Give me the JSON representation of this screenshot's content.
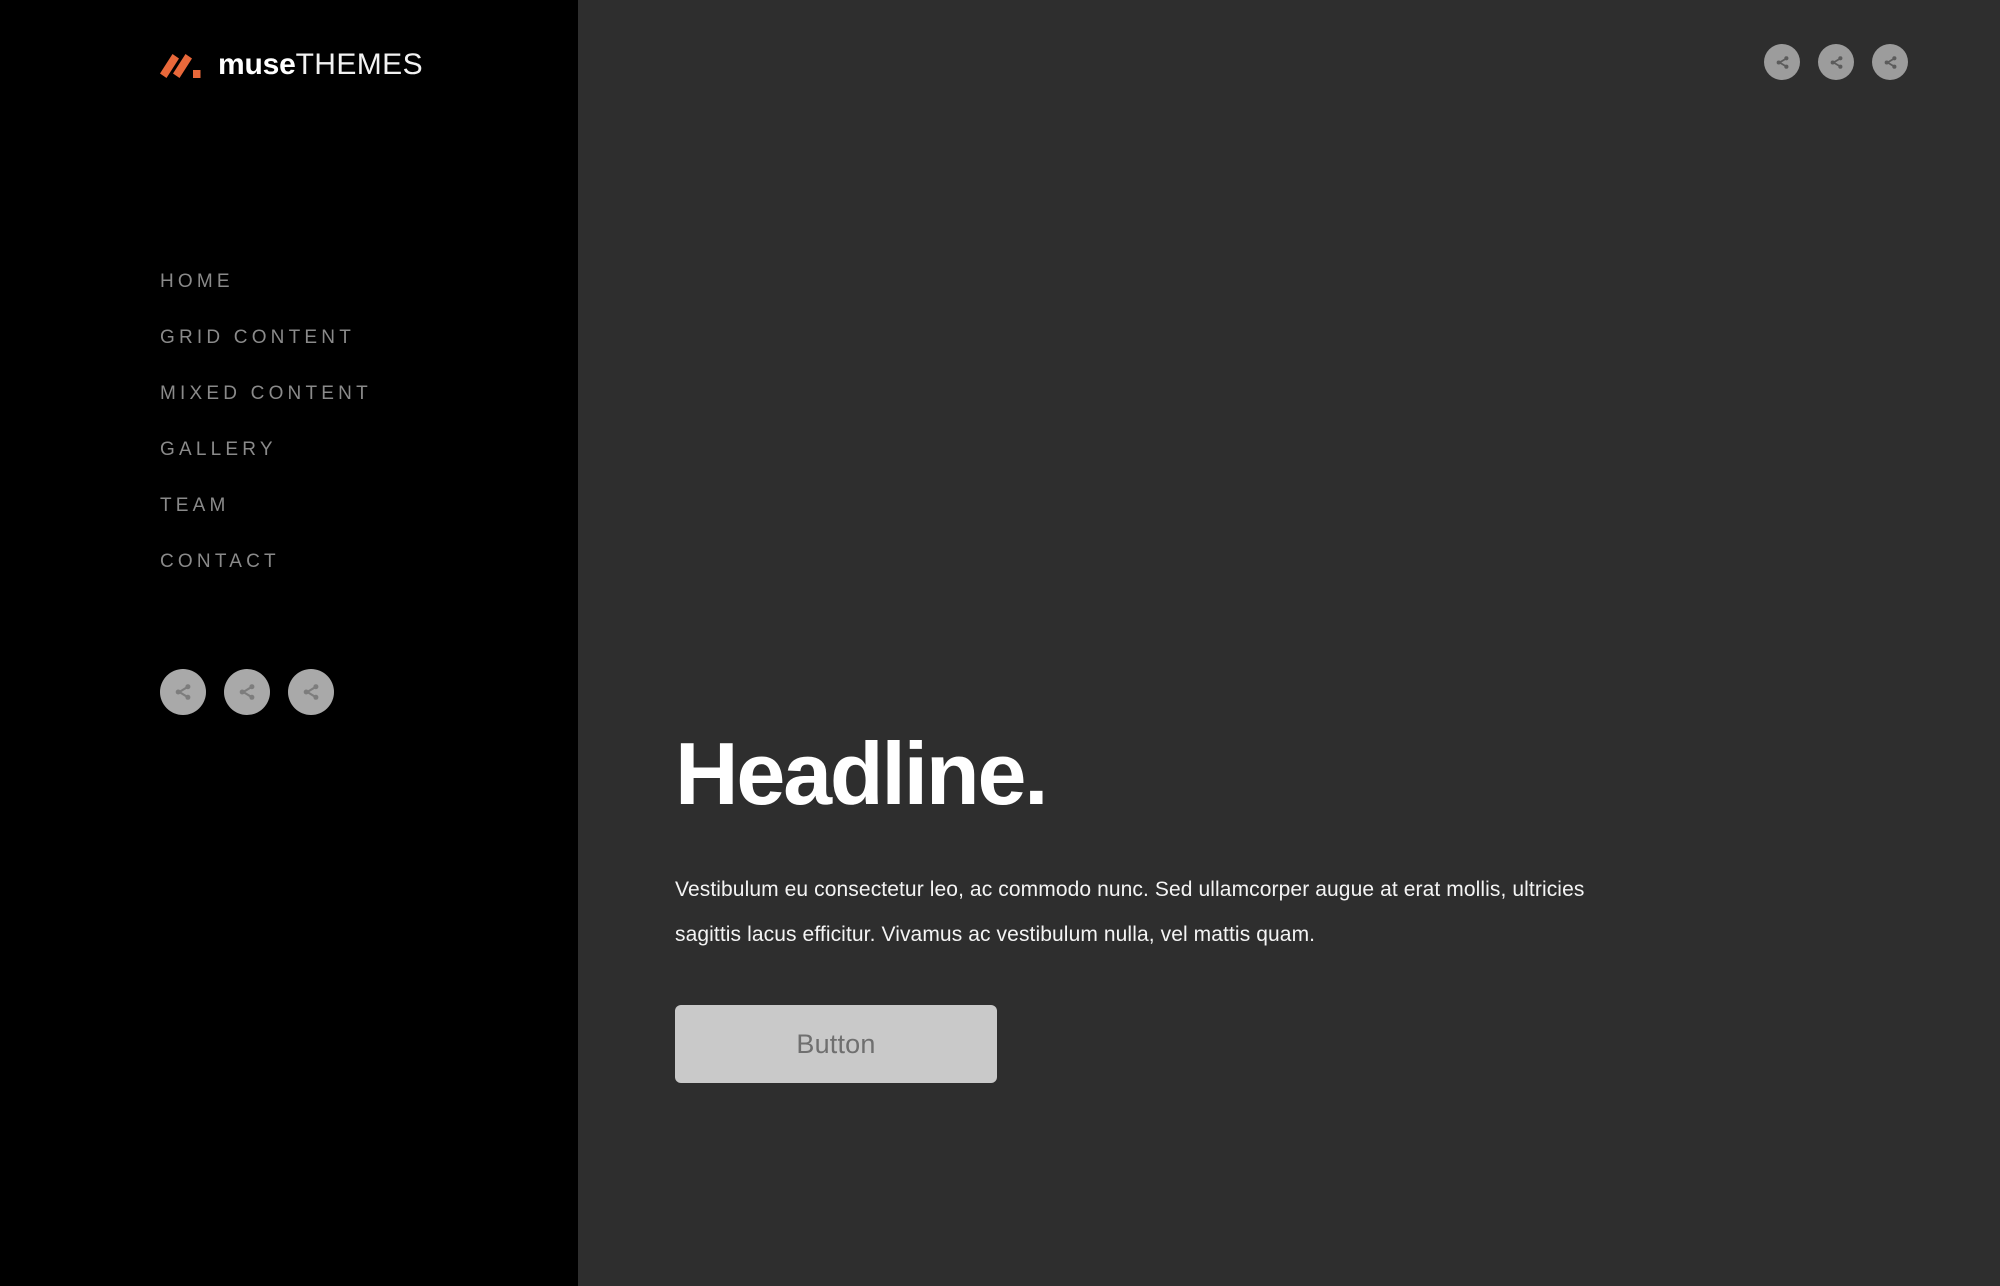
{
  "theme": {
    "sidebar_bg": "#000000",
    "main_bg": "#2e2e2e",
    "accent_orange": "#e9683a",
    "nav_text": "#8a8a8a",
    "headline_text": "#ffffff",
    "button_bg": "#c9c9c9",
    "button_text": "#6f6f6f",
    "social_circle": "#a9a9a9"
  },
  "sidebar": {
    "logo": {
      "mark_name": "muse-chevron-mark",
      "primary": "muse",
      "secondary": "THEMES"
    },
    "nav": {
      "items": [
        {
          "label": "HOME"
        },
        {
          "label": "GRID CONTENT"
        },
        {
          "label": "MIXED CONTENT"
        },
        {
          "label": "GALLERY"
        },
        {
          "label": "TEAM"
        },
        {
          "label": "CONTACT"
        }
      ]
    },
    "social": {
      "icons": [
        {
          "name": "share-icon"
        },
        {
          "name": "share-icon"
        },
        {
          "name": "share-icon"
        }
      ]
    }
  },
  "main": {
    "top_social": {
      "icons": [
        {
          "name": "share-icon"
        },
        {
          "name": "share-icon"
        },
        {
          "name": "share-icon"
        }
      ]
    },
    "hero": {
      "headline": "Headline.",
      "body": "Vestibulum eu consectetur leo, ac commodo nunc. Sed ullamcorper augue at erat mollis, ultricies sagittis lacus efficitur. Vivamus ac vestibulum nulla, vel mattis quam.",
      "button_label": "Button"
    }
  }
}
